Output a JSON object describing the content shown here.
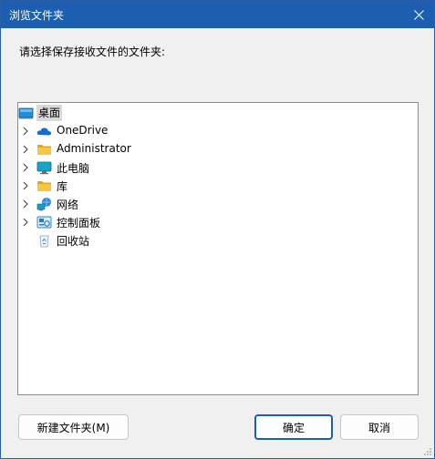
{
  "dialog": {
    "title": "浏览文件夹",
    "prompt": "请选择保存接收文件的文件夹:"
  },
  "tree": {
    "items": [
      {
        "label": "桌面",
        "icon": "desktop-icon",
        "expandable": false,
        "selected": true
      },
      {
        "label": "OneDrive",
        "icon": "cloud-icon",
        "expandable": true
      },
      {
        "label": "Administrator",
        "icon": "folder-icon",
        "expandable": true
      },
      {
        "label": "此电脑",
        "icon": "computer-icon",
        "expandable": true
      },
      {
        "label": "库",
        "icon": "folder-icon",
        "expandable": true
      },
      {
        "label": "网络",
        "icon": "network-icon",
        "expandable": true
      },
      {
        "label": "控制面板",
        "icon": "control-panel-icon",
        "expandable": true
      },
      {
        "label": "回收站",
        "icon": "recycle-bin-icon",
        "expandable": false
      }
    ]
  },
  "buttons": {
    "new_folder_label": "新建文件夹(M)",
    "ok_label": "确定",
    "cancel_label": "取消"
  },
  "colors": {
    "titlebar": "#1c5fb0",
    "dialog_bg": "#f0f0f0",
    "selection": "#d9d9d9",
    "focus_border": "#1c5fb0"
  }
}
